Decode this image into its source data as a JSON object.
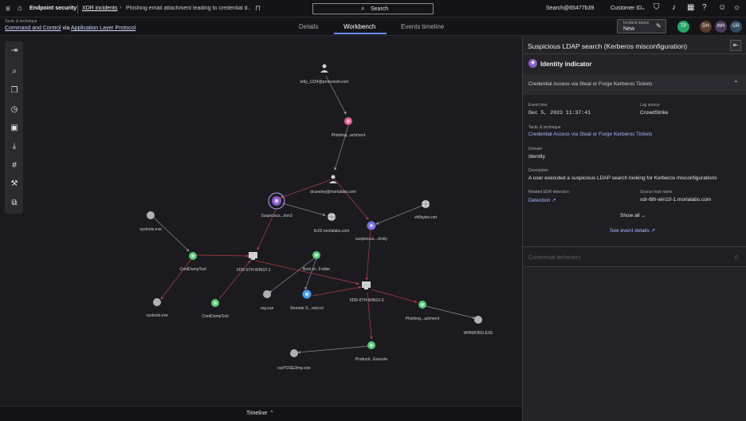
{
  "header": {
    "app_name": "Endpoint security",
    "breadcrumb_link": "XDR incidents",
    "incident_title": "Phishing email attachment leading to credential d...",
    "search_label": "Search",
    "user": "Search@65477b39",
    "customer_label": "Customer ID"
  },
  "subheader": {
    "tactic_label": "Tactic & technique",
    "tactic": "Command and Control",
    "via": "via",
    "technique": "Application Layer Protocol",
    "tabs": [
      "Details",
      "Workbench",
      "Events timeline"
    ],
    "active_tab": "Workbench",
    "status_label": "Incident status",
    "status_value": "New",
    "avatars": [
      {
        "initials": "TP",
        "color": "#2aa36a"
      },
      {
        "initials": "DH",
        "color": "#5a3d2e"
      },
      {
        "initials": "WH",
        "color": "#4a3a5e"
      },
      {
        "initials": "GR",
        "color": "#2e4a5e"
      }
    ]
  },
  "graph": {
    "nodes": [
      {
        "id": "u1",
        "label": "lefty_1234@prmosnetl.com",
        "type": "user"
      },
      {
        "id": "pa1",
        "label": "Phishing...achment",
        "type": "pink"
      },
      {
        "id": "u2",
        "label": "dcuneley@morlalabs.com",
        "type": "user"
      },
      {
        "id": "sel",
        "label": "Suspicious...tion3",
        "type": "selected"
      },
      {
        "id": "web1",
        "label": "6c02.morlalabs.com",
        "type": "globe"
      },
      {
        "id": "web2",
        "label": "vhflaytes.net",
        "type": "globe"
      },
      {
        "id": "sa",
        "label": "suspicious...ctivity",
        "type": "purple"
      },
      {
        "id": "st1",
        "label": "systools.exe",
        "type": "gray"
      },
      {
        "id": "cd1",
        "label": "CredDumpTool",
        "type": "green"
      },
      {
        "id": "h1",
        "label": "XDR-6TH-WIN10-1",
        "type": "host"
      },
      {
        "id": "bf",
        "label": "Boot or...Folder",
        "type": "green"
      },
      {
        "id": "h2",
        "label": "XDR-6TH-WIN10-3",
        "type": "host"
      },
      {
        "id": "st2",
        "label": "systools.exe",
        "type": "gray"
      },
      {
        "id": "cd2",
        "label": "CredDumpTool",
        "type": "green"
      },
      {
        "id": "reg",
        "label": "reg.exe",
        "type": "gray"
      },
      {
        "id": "rp",
        "label": "Remote S...rotocol",
        "type": "blue"
      },
      {
        "id": "pa2",
        "label": "Phishing...achment",
        "type": "green"
      },
      {
        "id": "ww",
        "label": "WINWORD.EXE",
        "type": "gray"
      },
      {
        "id": "pe",
        "label": "Producti...Execute",
        "type": "green"
      },
      {
        "id": "rad",
        "label": "racPOSE2tmp.exe",
        "type": "gray"
      }
    ]
  },
  "toolbar": {
    "icons": [
      "panel-toggle-icon",
      "search-icon",
      "copy-icon",
      "history-icon",
      "image-icon",
      "download-icon",
      "grid-icon",
      "tools-icon",
      "export-icon"
    ]
  },
  "timeline": {
    "label": "Timeline"
  },
  "panel": {
    "title": "Suspicious LDAP search (Kerberos misconfiguration)",
    "indicator_title": "Identity indicator",
    "section_title": "Credential Access via Steal or Forge Kerberos Tickets",
    "event_time_label": "Event time",
    "event_time": "Dec 5, 2023 11:37:41",
    "log_source_label": "Log source",
    "log_source": "CrowdStrike",
    "tactic_label": "Tactic & technique",
    "tactic_value": "Credential Access via Steal or Forge Kerberos Tickets",
    "domain_label": "Domain",
    "domain_value": "Identity",
    "description_label": "Description",
    "description_value": "A user executed a suspicious LDAP search looking for Kerberos misconfigurations",
    "related_label": "Related EDR detection",
    "related_value": "Detection",
    "source_host_label": "Source host name",
    "source_host_value": "xdr-6th-win10-1.morlalabs.com",
    "show_all": "Show all",
    "see_event": "See event details",
    "contextual": "Contextual behaviors",
    "contextual_count": "0"
  }
}
